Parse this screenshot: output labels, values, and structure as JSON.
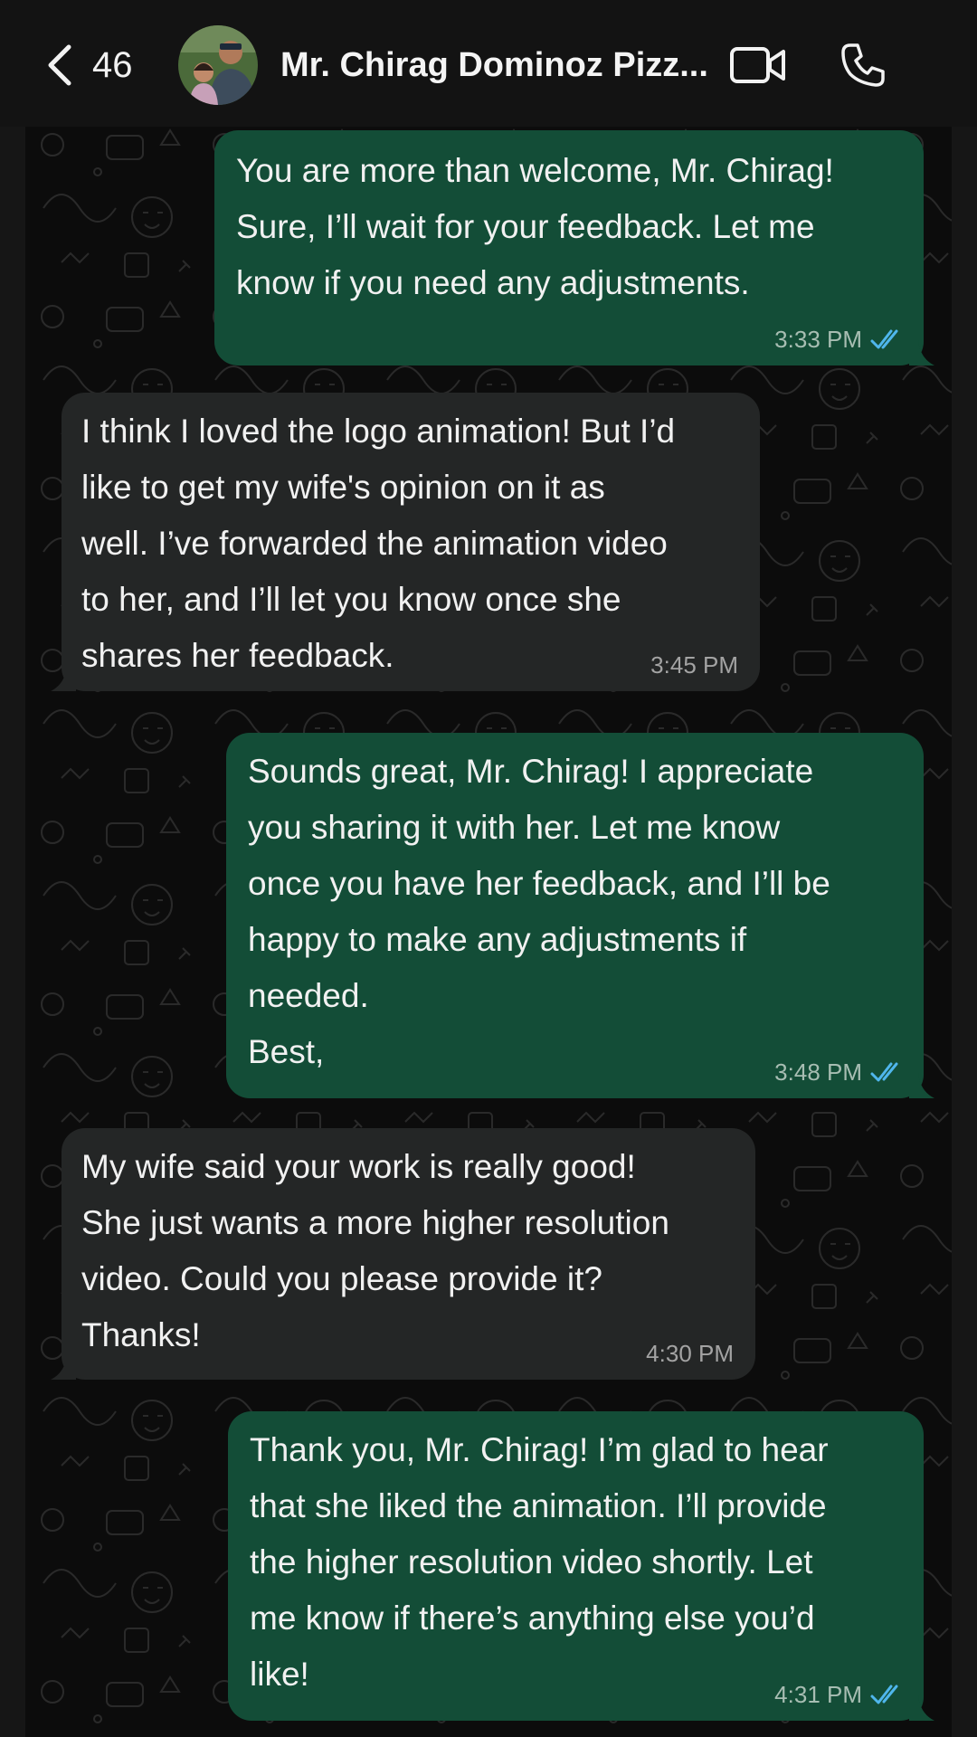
{
  "header": {
    "back_count": "46",
    "contact_name": "Mr. Chirag Dominoz Pizz..."
  },
  "messages": [
    {
      "direction": "out",
      "text": "You are more than welcome, Mr. Chirag!\nSure, I’ll wait for your feedback. Let me\nknow if you need any adjustments.",
      "time": "3:33 PM",
      "status": "read"
    },
    {
      "direction": "in",
      "text": "I think I loved the logo animation! But I’d\nlike to get my wife's opinion on it as\nwell. I’ve forwarded the animation video\nto her, and I’ll let you know once she\nshares her feedback.",
      "time": "3:45 PM"
    },
    {
      "direction": "out",
      "text": "Sounds great, Mr. Chirag! I appreciate\nyou sharing it with her. Let me know\nonce you have her feedback, and I’ll be\nhappy to make any adjustments if\nneeded.\nBest,",
      "time": "3:48 PM",
      "status": "read"
    },
    {
      "direction": "in",
      "text": "My wife said your work is really good!\nShe just wants a more higher resolution\nvideo. Could you please provide it?\nThanks!",
      "time": "4:30 PM"
    },
    {
      "direction": "out",
      "text": "Thank you, Mr. Chirag! I’m glad to hear\nthat she liked the animation. I’ll provide\nthe higher resolution video shortly. Let\nme know if there’s anything else you’d\nlike!",
      "time": "4:31 PM",
      "status": "read"
    }
  ],
  "colors": {
    "outgoing_bubble": "#134d37",
    "incoming_bubble": "#242626",
    "read_ticks": "#4fb6ec",
    "header_bg": "#131313"
  },
  "icons": {
    "back": "chevron-left-icon",
    "video": "video-camera-icon",
    "call": "phone-icon",
    "read_receipt": "double-check-icon"
  }
}
